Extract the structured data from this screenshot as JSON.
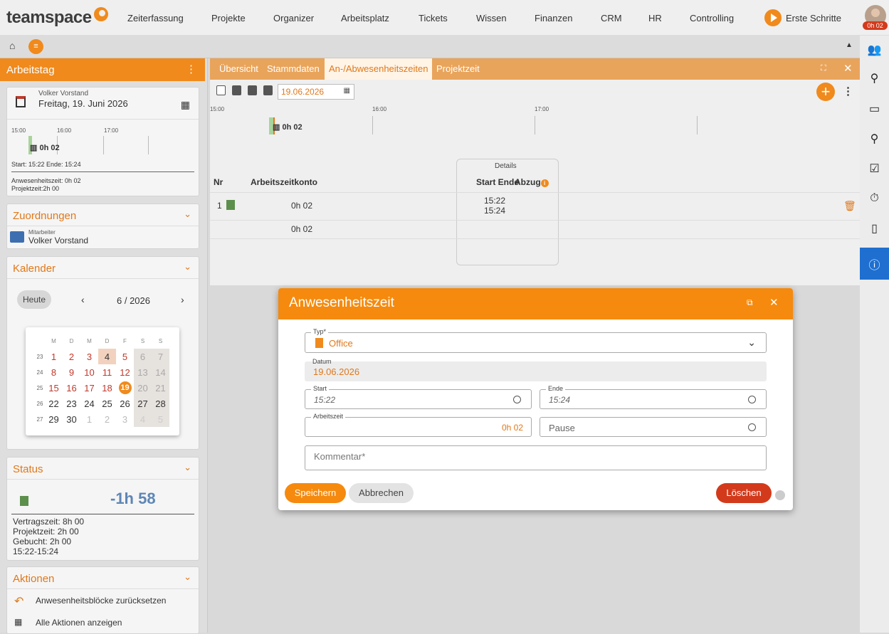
{
  "app": {
    "logo": "teamspace",
    "badge": "0h 02"
  },
  "nav": [
    "Zeiterfassung",
    "Projekte",
    "Organizer",
    "Arbeitsplatz",
    "Tickets",
    "Wissen",
    "Finanzen",
    "CRM",
    "HR",
    "Controlling"
  ],
  "erste_schritte": "Erste Schritte",
  "left": {
    "title": "Arbeitstag",
    "day": {
      "person": "Volker Vorstand",
      "date": "Freitag, 19. Juni 2026",
      "ticks": [
        "15:00",
        "16:00",
        "17:00"
      ],
      "block": "0h 02",
      "range": "Start: 15:22 Ende: 15:24",
      "anwesenheit": "Anwesenheitszeit: 0h 02",
      "projektzeit": "Projektzeit:2h 00"
    },
    "zuordnungen": {
      "title": "Zuordnungen",
      "role": "Mitarbeiter",
      "name": "Volker Vorstand"
    },
    "kalender": {
      "title": "Kalender",
      "today": "Heute",
      "month": "6 / 2026",
      "weekdays": [
        "M",
        "D",
        "M",
        "D",
        "F",
        "S",
        "S"
      ],
      "weeks": [
        [
          "23",
          "1",
          "2",
          "3",
          "4",
          "5",
          "6",
          "7"
        ],
        [
          "24",
          "8",
          "9",
          "10",
          "11",
          "12",
          "13",
          "14"
        ],
        [
          "25",
          "15",
          "16",
          "17",
          "18",
          "19",
          "20",
          "21"
        ],
        [
          "26",
          "22",
          "23",
          "24",
          "25",
          "26",
          "27",
          "28"
        ],
        [
          "27",
          "29",
          "30",
          "1",
          "2",
          "3",
          "4",
          "5"
        ]
      ]
    },
    "status": {
      "title": "Status",
      "value": "-1h 58",
      "lines": [
        "Vertragszeit: 8h 00",
        "Projektzeit: 2h 00",
        "Gebucht: 2h 00",
        "15:22-15:24"
      ]
    },
    "aktionen": {
      "title": "Aktionen",
      "items": [
        "Anwesenheitsblöcke zurücksetzen",
        "Alle Aktionen anzeigen"
      ]
    }
  },
  "tabs": [
    "Übersicht",
    "Stammdaten",
    "An-/Abwesenheitszeiten",
    "Projektzeit"
  ],
  "toolbar": {
    "date": "19.06.2026"
  },
  "timeline": {
    "ticks": [
      "15:00",
      "16:00",
      "17:00"
    ],
    "block": "0h 02"
  },
  "table": {
    "details": "Details",
    "headers": [
      "Nr",
      "Arbeitszeitkonto",
      "Start Ende",
      "Abzug"
    ],
    "row": {
      "nr": "1",
      "konto": "0h 02",
      "start": "15:22",
      "ende": "15:24"
    },
    "sum": "0h 02"
  },
  "modal": {
    "title": "Anwesenheitszeit",
    "typ_label": "Typ*",
    "typ_value": "Office",
    "datum_label": "Datum",
    "datum_value": "19.06.2026",
    "start_label": "Start",
    "start_value": "15:22",
    "ende_label": "Ende",
    "ende_value": "15:24",
    "arbeitszeit_label": "Arbeitszeit",
    "arbeitszeit_value": "0h 02",
    "pause_placeholder": "Pause",
    "kommentar_placeholder": "Kommentar*",
    "save": "Speichern",
    "cancel": "Abbrechen",
    "delete": "Löschen"
  },
  "colors": {
    "accent": "#f08a1c",
    "danger": "#d33a1c",
    "active_blue": "#1e6fd0"
  }
}
